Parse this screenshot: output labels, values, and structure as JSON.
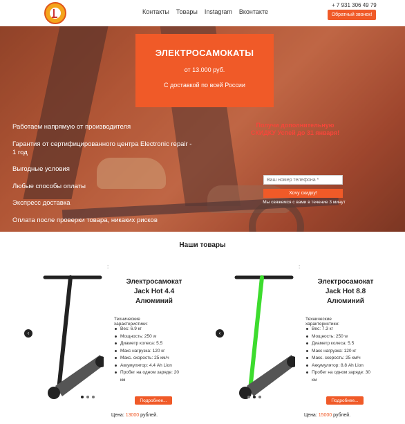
{
  "header": {
    "logo_icon": "company-logo",
    "nav": [
      "Контакты",
      "Товары",
      "Instagram",
      "Вконтакте"
    ],
    "phone": "+ 7 931 306 49 79",
    "callback_label": "Обратный звонок!"
  },
  "hero": {
    "promo": {
      "title": "ЭЛЕКТРОСАМОКАТЫ",
      "price": "от 13.000 руб.",
      "delivery": "С доставкой по всей России"
    },
    "features": [
      "Работаем напрямую от производителя",
      "Гарантия от сертифицированного центра Electronic repair - 1 год",
      "Выгодные условия",
      "Любые способы оплаты",
      "Экспресс доставка",
      "Оплата после проверки товара, никаких рисков"
    ],
    "discount_text": "Получи дополнительную СКИДКУ Успей до 31 января!",
    "phone_placeholder": "Ваш номер телефона *",
    "discount_button": "Хочу скидку!",
    "contact_note": "Мы свяжемся с вами в течение 3 минут"
  },
  "products": {
    "section_title": "Наши товары",
    "items": [
      {
        "title": "Электросамокат Jack Hot 4.4 Алюминий",
        "spec_header": "Технические характеристики:",
        "specs": [
          "Вес: 6.9 кг",
          "Мощность: 250 w",
          "Диаметр колеса: 5.5",
          "Макс нагрузка: 120 кг",
          "Макс. скорость: 25 км/ч",
          "Аккумулятор: 4.4 Ah Lion",
          "Пробег на одном заряде: 20 км"
        ],
        "more_label": "Подробнее...",
        "price_label": "Цена:",
        "price_value": "13000",
        "price_unit": "рублей.",
        "stem_color": "#222222"
      },
      {
        "title": "Электросамокат Jack Hot 8.8 Алюминий",
        "spec_header": "Технические характеристики:",
        "specs": [
          "Вес: 7.3 кг",
          "Мощность: 250 w",
          "Диаметр колеса: 5.5",
          "Макс нагрузка: 120 кг",
          "Макс. скорость: 25 км/ч",
          "Аккумулятор: 8.8 Ah Lion",
          "Пробег на одном заряде: 30 км"
        ],
        "more_label": "Подробнее...",
        "price_label": "Цена:",
        "price_value": "15000",
        "price_unit": "рублей.",
        "stem_color": "#3ddc2e"
      }
    ],
    "arrow_icon": "chevron-left-icon",
    "separator": ":"
  },
  "colors": {
    "accent": "#f05a28",
    "discount": "#f6463a"
  }
}
